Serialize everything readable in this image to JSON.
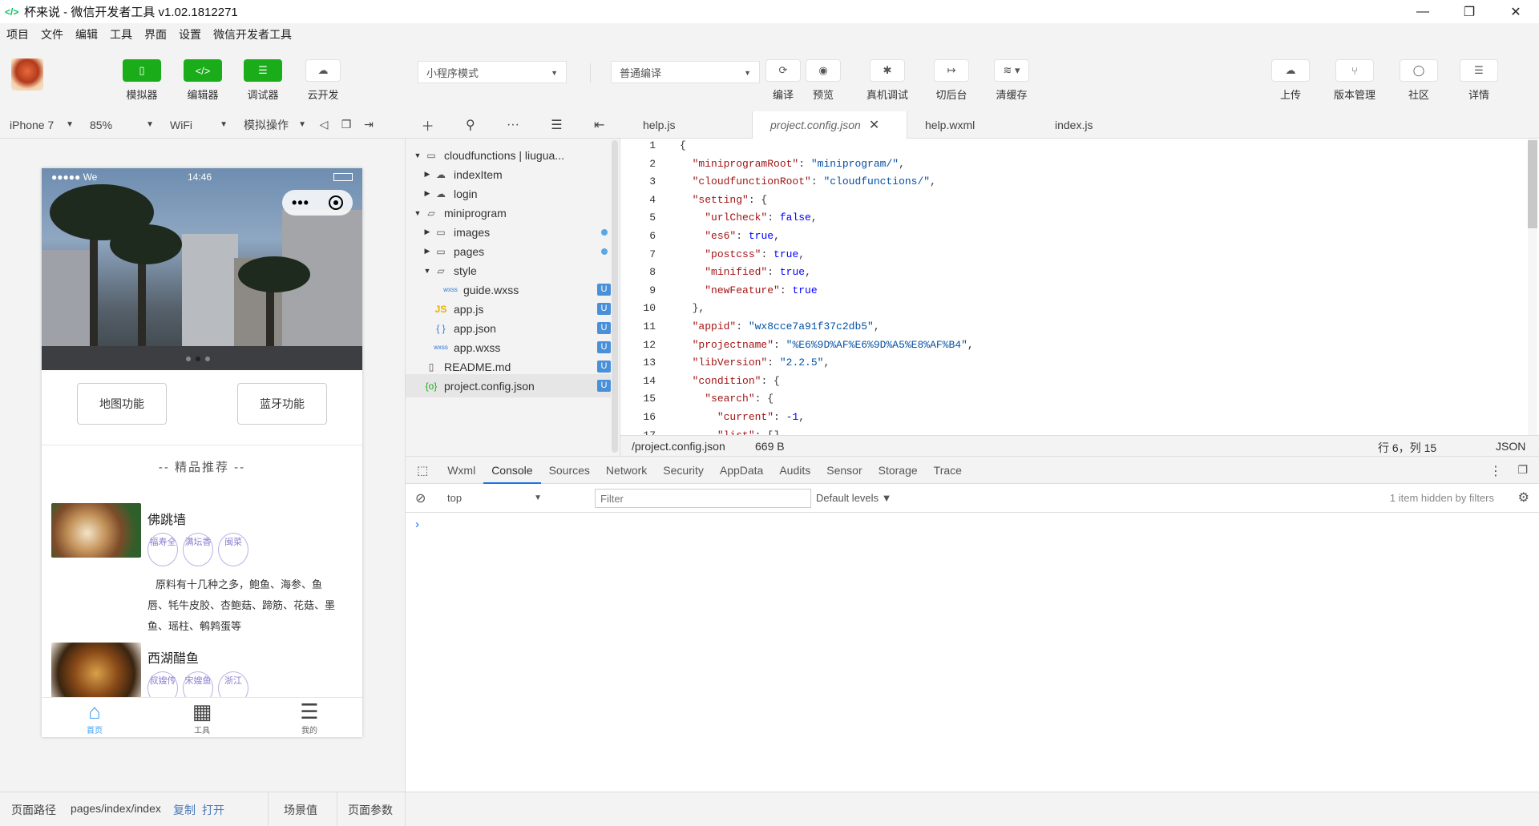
{
  "window": {
    "title": "杯来说 - 微信开发者工具 v1.02.1812271",
    "minimize": "—",
    "restore": "❐",
    "close": "✕"
  },
  "menu": [
    "项目",
    "文件",
    "编辑",
    "工具",
    "界面",
    "设置",
    "微信开发者工具"
  ],
  "toolbar": {
    "simulator": "模拟器",
    "editor": "编辑器",
    "debugger": "调试器",
    "cloud": "云开发",
    "mode": "小程序模式",
    "compile_mode": "普通编译",
    "compile": "编译",
    "preview": "预览",
    "real_debug": "真机调试",
    "background": "切后台",
    "clear_cache": "清缓存",
    "upload": "上传",
    "version": "版本管理",
    "community": "社区",
    "details": "详情"
  },
  "sim_header": {
    "device": "iPhone 7",
    "zoom": "85%",
    "network": "WiFi",
    "operation": "模拟操作"
  },
  "phone": {
    "signal": "●●●●● We",
    "time": "14:46",
    "btn_map": "地图功能",
    "btn_bluetooth": "蓝牙功能",
    "section_title": "-- 精品推荐 --",
    "dishes": [
      {
        "name": "佛跳墙",
        "tags": [
          "福寿全",
          "满坛香",
          "闽菜"
        ],
        "desc": "原料有十几种之多，鲍鱼、海参、鱼唇、牦牛皮胶、杏鲍菇、蹄筋、花菇、墨鱼、瑶柱、鹌鹑蛋等"
      },
      {
        "name": "西湖醋鱼",
        "tags": [
          "叔嫂传",
          "宋嫂鱼",
          "浙江"
        ]
      }
    ],
    "tabs": [
      {
        "label": "首页",
        "icon": "home-icon"
      },
      {
        "label": "工具",
        "icon": "tools-icon"
      },
      {
        "label": "我的",
        "icon": "profile-icon"
      }
    ]
  },
  "filetree": [
    {
      "label": "cloudfunctions | liugua...",
      "type": "cloud-folder-open",
      "depth": 0,
      "arrow": "▼"
    },
    {
      "label": "indexItem",
      "type": "cloud",
      "depth": 1,
      "arrow": "▶"
    },
    {
      "label": "login",
      "type": "cloud",
      "depth": 1,
      "arrow": "▶"
    },
    {
      "label": "miniprogram",
      "type": "folder-open",
      "depth": 0,
      "arrow": "▼"
    },
    {
      "label": "images",
      "type": "folder",
      "depth": 1,
      "arrow": "▶",
      "dot": true
    },
    {
      "label": "pages",
      "type": "folder",
      "depth": 1,
      "arrow": "▶",
      "dot": true
    },
    {
      "label": "style",
      "type": "folder-open",
      "depth": 1,
      "arrow": "▼"
    },
    {
      "label": "guide.wxss",
      "type": "wxss",
      "depth": 2,
      "badge": "U"
    },
    {
      "label": "app.js",
      "type": "js",
      "depth": 1,
      "badge": "U"
    },
    {
      "label": "app.json",
      "type": "json",
      "depth": 1,
      "badge": "U"
    },
    {
      "label": "app.wxss",
      "type": "wxss",
      "depth": 1,
      "badge": "U"
    },
    {
      "label": "README.md",
      "type": "file",
      "depth": 0,
      "badge": "U"
    },
    {
      "label": "project.config.json",
      "type": "config",
      "depth": 0,
      "badge": "U",
      "selected": true
    }
  ],
  "editor_tabs": [
    {
      "label": "help.js"
    },
    {
      "label": "project.config.json",
      "active": true
    },
    {
      "label": "help.wxml"
    },
    {
      "label": "index.js"
    }
  ],
  "code": [
    {
      "n": "1",
      "parts": [
        [
          "p",
          "{"
        ]
      ]
    },
    {
      "n": "2",
      "parts": [
        [
          "p",
          "  "
        ],
        [
          "k",
          "\"miniprogramRoot\""
        ],
        [
          "p",
          ": "
        ],
        [
          "s",
          "\"miniprogram/\""
        ],
        [
          "p",
          ","
        ]
      ]
    },
    {
      "n": "3",
      "parts": [
        [
          "p",
          "  "
        ],
        [
          "k",
          "\"cloudfunctionRoot\""
        ],
        [
          "p",
          ": "
        ],
        [
          "s",
          "\"cloudfunctions/\""
        ],
        [
          "p",
          ","
        ]
      ]
    },
    {
      "n": "4",
      "parts": [
        [
          "p",
          "  "
        ],
        [
          "k",
          "\"setting\""
        ],
        [
          "p",
          ": {"
        ]
      ]
    },
    {
      "n": "5",
      "parts": [
        [
          "p",
          "    "
        ],
        [
          "k",
          "\"urlCheck\""
        ],
        [
          "p",
          ": "
        ],
        [
          "b",
          "false"
        ],
        [
          "p",
          ","
        ]
      ]
    },
    {
      "n": "6",
      "parts": [
        [
          "p",
          "    "
        ],
        [
          "k",
          "\"es6\""
        ],
        [
          "p",
          ": "
        ],
        [
          "b",
          "true"
        ],
        [
          "p",
          ","
        ]
      ]
    },
    {
      "n": "7",
      "parts": [
        [
          "p",
          "    "
        ],
        [
          "k",
          "\"postcss\""
        ],
        [
          "p",
          ": "
        ],
        [
          "b",
          "true"
        ],
        [
          "p",
          ","
        ]
      ]
    },
    {
      "n": "8",
      "parts": [
        [
          "p",
          "    "
        ],
        [
          "k",
          "\"minified\""
        ],
        [
          "p",
          ": "
        ],
        [
          "b",
          "true"
        ],
        [
          "p",
          ","
        ]
      ]
    },
    {
      "n": "9",
      "parts": [
        [
          "p",
          "    "
        ],
        [
          "k",
          "\"newFeature\""
        ],
        [
          "p",
          ": "
        ],
        [
          "b",
          "true"
        ]
      ]
    },
    {
      "n": "10",
      "parts": [
        [
          "p",
          "  },"
        ]
      ]
    },
    {
      "n": "11",
      "parts": [
        [
          "p",
          "  "
        ],
        [
          "k",
          "\"appid\""
        ],
        [
          "p",
          ": "
        ],
        [
          "s",
          "\"wx8cce7a91f37c2db5\""
        ],
        [
          "p",
          ","
        ]
      ]
    },
    {
      "n": "12",
      "parts": [
        [
          "p",
          "  "
        ],
        [
          "k",
          "\"projectname\""
        ],
        [
          "p",
          ": "
        ],
        [
          "s",
          "\"%E6%9D%AF%E6%9D%A5%E8%AF%B4\""
        ],
        [
          "p",
          ","
        ]
      ]
    },
    {
      "n": "13",
      "parts": [
        [
          "p",
          "  "
        ],
        [
          "k",
          "\"libVersion\""
        ],
        [
          "p",
          ": "
        ],
        [
          "s",
          "\"2.2.5\""
        ],
        [
          "p",
          ","
        ]
      ]
    },
    {
      "n": "14",
      "parts": [
        [
          "p",
          "  "
        ],
        [
          "k",
          "\"condition\""
        ],
        [
          "p",
          ": {"
        ]
      ]
    },
    {
      "n": "15",
      "parts": [
        [
          "p",
          "    "
        ],
        [
          "k",
          "\"search\""
        ],
        [
          "p",
          ": {"
        ]
      ]
    },
    {
      "n": "16",
      "parts": [
        [
          "p",
          "      "
        ],
        [
          "k",
          "\"current\""
        ],
        [
          "p",
          ": "
        ],
        [
          "b",
          "-1"
        ],
        [
          "p",
          ","
        ]
      ]
    },
    {
      "n": "17",
      "parts": [
        [
          "p",
          "      "
        ],
        [
          "k",
          "\"list\""
        ],
        [
          "p",
          ": []"
        ]
      ]
    }
  ],
  "editor_status": {
    "path": "/project.config.json",
    "size": "669 B",
    "position": "行 6，列 15",
    "lang": "JSON"
  },
  "devtools": {
    "tabs": [
      "Wxml",
      "Console",
      "Sources",
      "Network",
      "Security",
      "AppData",
      "Audits",
      "Sensor",
      "Storage",
      "Trace"
    ],
    "active_tab": "Console",
    "context": "top",
    "filter_placeholder": "Filter",
    "levels": "Default levels ▼",
    "hidden": "1 item hidden by filters",
    "prompt": "›"
  },
  "bottom": {
    "path_label": "页面路径",
    "path": "pages/index/index",
    "copy": "复制",
    "open": "打开",
    "scene": "场景值",
    "params": "页面参数"
  }
}
